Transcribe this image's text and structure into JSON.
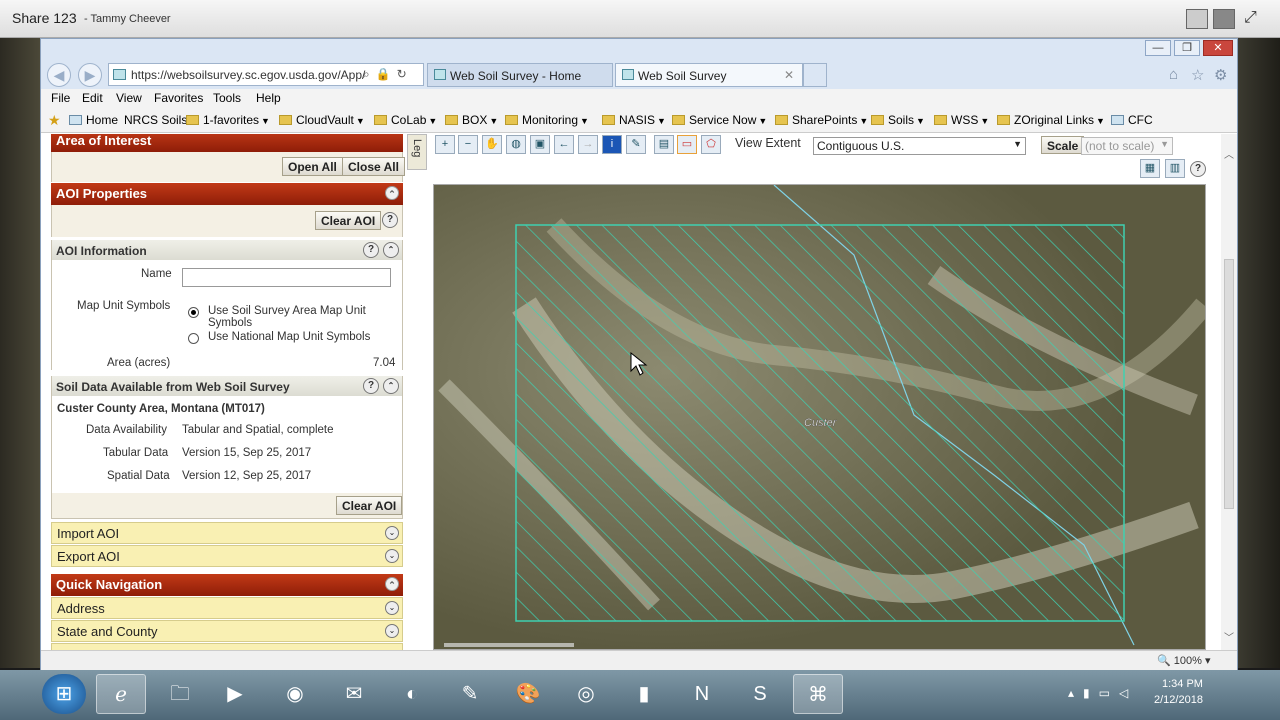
{
  "share": {
    "title": "Share 123",
    "user": "- Tammy Cheever"
  },
  "browser": {
    "url": "https://websoilsurvey.sc.egov.usda.gov/App/",
    "tabs": [
      {
        "label": "Web Soil Survey - Home"
      },
      {
        "label": "Web Soil Survey"
      }
    ],
    "tab_close": "✕",
    "window_controls": {
      "min": "—",
      "restore": "❐",
      "close": "✕"
    }
  },
  "menu": [
    "File",
    "Edit",
    "View",
    "Favorites",
    "Tools",
    "Help"
  ],
  "favorites": [
    {
      "label": "Home",
      "icon": "page-icon"
    },
    {
      "label": "NRCS Soils",
      "icon": "page-icon"
    },
    {
      "label": "1-favorites",
      "icon": "folder-icon",
      "dropdown": true
    },
    {
      "label": "CloudVault",
      "icon": "folder-icon",
      "dropdown": true
    },
    {
      "label": "CoLab",
      "icon": "folder-icon",
      "dropdown": true
    },
    {
      "label": "BOX",
      "icon": "folder-icon",
      "dropdown": true
    },
    {
      "label": "Monitoring",
      "icon": "folder-icon",
      "dropdown": true
    },
    {
      "label": "NASIS",
      "icon": "folder-icon",
      "dropdown": true
    },
    {
      "label": "Service Now",
      "icon": "folder-icon",
      "dropdown": true
    },
    {
      "label": "SharePoints",
      "icon": "folder-icon",
      "dropdown": true
    },
    {
      "label": "Soils",
      "icon": "folder-icon",
      "dropdown": true
    },
    {
      "label": "WSS",
      "icon": "folder-icon",
      "dropdown": true
    },
    {
      "label": "ZOriginal Links",
      "icon": "folder-icon",
      "dropdown": true
    },
    {
      "label": "CFC",
      "icon": "page-icon"
    }
  ],
  "panel": {
    "aoi_title": "Area of Interest",
    "open_all": "Open All",
    "close_all": "Close All",
    "aoi_props_title": "AOI Properties",
    "clear_aoi": "Clear AOI",
    "help": "?",
    "aoi_info_title": "AOI Information",
    "name_label": "Name",
    "name_value": "",
    "map_unit_label": "Map Unit Symbols",
    "radio_1": "Use Soil Survey Area Map Unit Symbols",
    "radio_2": "Use National Map Unit Symbols",
    "area_label": "Area (acres)",
    "area_value": "7.04",
    "soil_data_title": "Soil Data Available from Web Soil Survey",
    "survey_area": "Custer County Area, Montana (MT017)",
    "rows": [
      {
        "label": "Data Availability",
        "value": "Tabular and Spatial, complete"
      },
      {
        "label": "Tabular Data",
        "value": "Version 15, Sep 25, 2017"
      },
      {
        "label": "Spatial Data",
        "value": "Version 12, Sep 25, 2017"
      }
    ],
    "import_aoi": "Import AOI",
    "export_aoi": "Export AOI",
    "quick_nav_title": "Quick Navigation",
    "address": "Address",
    "state_county": "State and County"
  },
  "map": {
    "view_extent_label": "View Extent",
    "view_extent_value": "Contiguous U.S.",
    "scale_label": "Scale",
    "scale_value": "(not to scale)",
    "place_label": "Custer",
    "legend_tab": "Leg"
  },
  "status": {
    "zoom": "100%"
  },
  "taskbar": {
    "time": "1:34 PM",
    "date": "2/12/2018"
  },
  "colors": {
    "aoi_hatch": "#3fd0b0",
    "header_dark": "#a52a0e",
    "panel_yellow": "#f9f0b3"
  }
}
